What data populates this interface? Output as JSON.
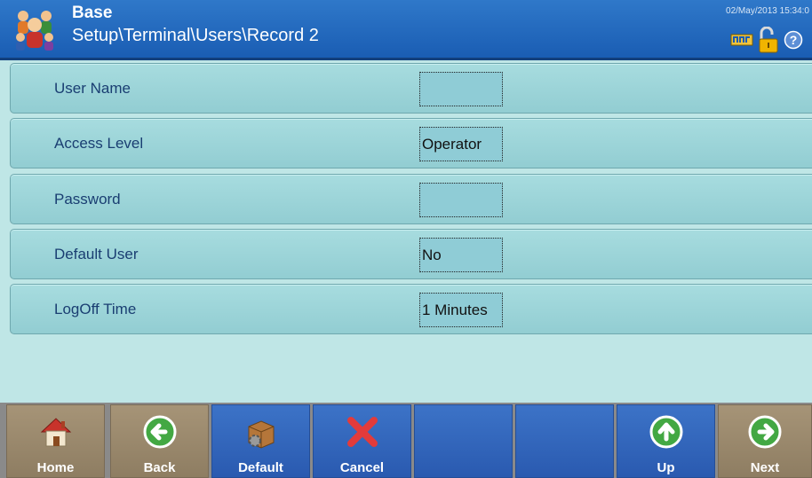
{
  "header": {
    "title": "Base",
    "breadcrumb": "Setup\\Terminal\\Users\\Record 2",
    "datetime": "02/May/2013 15:34:0"
  },
  "rows": [
    {
      "label": "User Name",
      "value": ""
    },
    {
      "label": "Access Level",
      "value": "Operator"
    },
    {
      "label": "Password",
      "value": ""
    },
    {
      "label": "Default User",
      "value": "No"
    },
    {
      "label": "LogOff Time",
      "value": "1 Minutes"
    }
  ],
  "toolbar": {
    "home_label": "Home",
    "back_label": "Back",
    "default_label": "Default",
    "cancel_label": "Cancel",
    "up_label": "Up",
    "next_label": "Next"
  },
  "icons": {
    "app": "users-group-icon",
    "status": [
      "network-icon",
      "padlock-unlocked-icon",
      "help-icon"
    ],
    "home": "house-icon",
    "back": "arrow-left-circle-icon",
    "default": "box-gear-icon",
    "cancel": "red-x-icon",
    "up": "arrow-up-circle-icon",
    "next": "arrow-right-circle-icon"
  },
  "colors": {
    "header": "#1f63b8",
    "row": "#9fd5d9",
    "label_text": "#1a3e72",
    "softkey_tan": "#9a8a6e",
    "softkey_blue": "#3367bf"
  }
}
